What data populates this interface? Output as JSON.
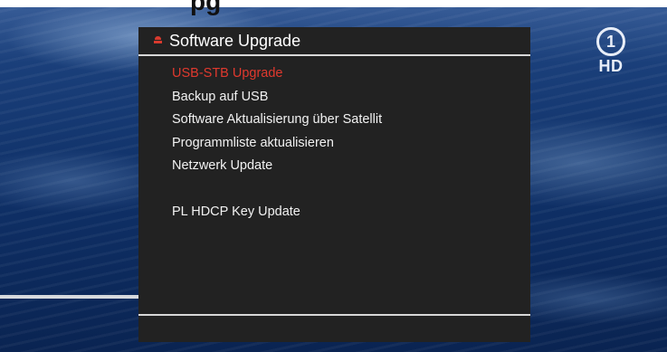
{
  "background": {
    "top_title_fragment": "pg"
  },
  "channel_logo": {
    "number": "1",
    "label": "HD",
    "icon": "das-erste-logo-icon"
  },
  "dialog": {
    "title": "Software Upgrade",
    "header_icon": "menu-bullet-icon",
    "accent_color": "#e0392e",
    "panel_color": "#222222",
    "items": [
      {
        "label": "USB-STB Upgrade",
        "selected": true
      },
      {
        "label": "Backup auf USB",
        "selected": false
      },
      {
        "label": "Software Aktualisierung über Satellit",
        "selected": false
      },
      {
        "label": "Programmliste aktualisieren",
        "selected": false
      },
      {
        "label": "Netzwerk Update",
        "selected": false
      },
      {
        "label": "PL HDCP Key Update",
        "selected": false
      }
    ]
  }
}
